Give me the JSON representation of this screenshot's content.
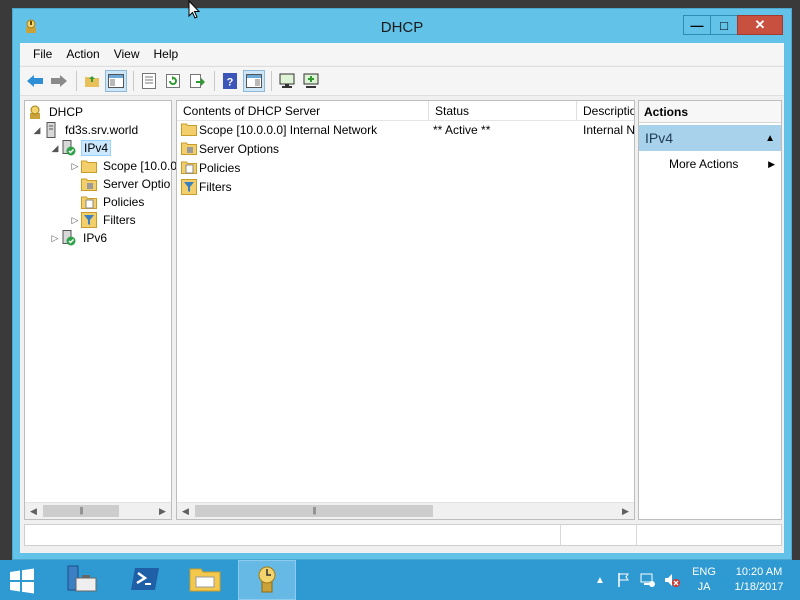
{
  "window": {
    "title": "DHCP"
  },
  "window_controls": {
    "minimize": "—",
    "maximize": "□",
    "close": "✕"
  },
  "menu": [
    "File",
    "Action",
    "View",
    "Help"
  ],
  "toolbar": {
    "buttons": [
      "back-icon",
      "forward-icon",
      "up-folder-icon",
      "show-hide-console-tree-icon",
      "properties-icon",
      "refresh-icon",
      "export-list-icon",
      "help-icon",
      "show-hide-action-pane-icon",
      "display-statistics-icon",
      "add-server-icon"
    ]
  },
  "tree": {
    "root": "DHCP",
    "server": "fd3s.srv.world",
    "ipv4": "IPv4",
    "scope": "Scope [10.0.0.",
    "server_options": "Server Optio",
    "policies": "Policies",
    "filters": "Filters",
    "ipv6": "IPv6"
  },
  "list": {
    "columns": [
      "Contents of DHCP Server",
      "Status",
      "Descriptio"
    ],
    "rows": [
      {
        "name": "Scope [10.0.0.0] Internal Network",
        "status": "** Active **",
        "description": "Internal N",
        "icon": "folder-icon"
      },
      {
        "name": "Server Options",
        "status": "",
        "description": "",
        "icon": "server-options-icon"
      },
      {
        "name": "Policies",
        "status": "",
        "description": "",
        "icon": "policies-icon"
      },
      {
        "name": "Filters",
        "status": "",
        "description": "",
        "icon": "filters-icon"
      }
    ]
  },
  "actions": {
    "header": "Actions",
    "group": "IPv4",
    "items": [
      "More Actions"
    ]
  },
  "taskbar": {
    "apps": [
      "server-manager-icon",
      "powershell-icon",
      "file-explorer-icon",
      "dhcp-icon"
    ],
    "active_app": "dhcp-icon",
    "lang_top": "ENG",
    "lang_bottom": "JA",
    "time": "10:20 AM",
    "date": "1/18/2017"
  },
  "colors": {
    "titlebar": "#63c2e8",
    "close_button": "#c7503f",
    "taskbar": "#2f9ad2",
    "actions_group": "#a8d1ec",
    "selection": "#cce8ff"
  }
}
